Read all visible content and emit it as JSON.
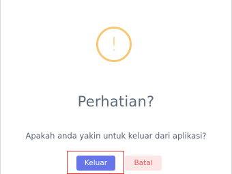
{
  "dialog": {
    "icon": "exclamation-icon",
    "icon_glyph": "!",
    "title": "Perhatian?",
    "message": "Apakah anda yakin untuk keluar dari aplikasi?",
    "confirm_label": "Keluar",
    "cancel_label": "Batal"
  },
  "colors": {
    "warning": "#f7c873",
    "primary": "#6675e8",
    "danger_text": "#ea5b5b",
    "danger_bg": "#fde6e6",
    "highlight": "#e53935"
  }
}
